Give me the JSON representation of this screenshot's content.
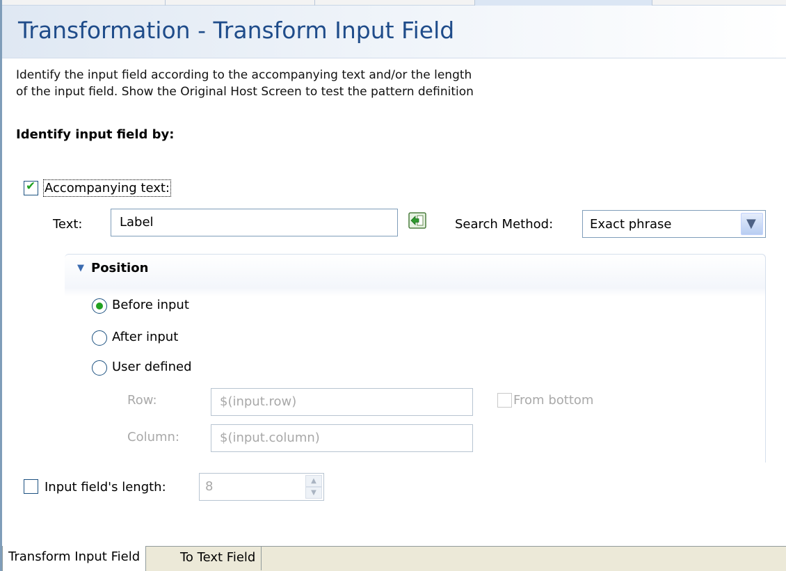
{
  "page": {
    "title": "Transformation - Transform Input Field",
    "description_line1": "Identify the input field according to the accompanying text and/or the length",
    "description_line2": "of the input field. Show the Original Host Screen to test the pattern definition",
    "section_heading": "Identify input field by:"
  },
  "accompanying": {
    "checkbox_label": "Accompanying text:",
    "checked": true,
    "text_label": "Text:",
    "text_value": "Label",
    "insert_icon": "insert-variable-icon",
    "search_method_label": "Search Method:",
    "search_method_value": "Exact phrase"
  },
  "position": {
    "header": "Position",
    "options": [
      "Before input",
      "After input",
      "User defined"
    ],
    "selected": "Before input",
    "row_label": "Row:",
    "row_value": "$(input.row)",
    "column_label": "Column:",
    "column_value": "$(input.column)",
    "from_bottom_label": "From bottom"
  },
  "length": {
    "checkbox_label": "Input field's length:",
    "checked": false,
    "value": "8"
  },
  "tabs": [
    "Transform Input Field",
    "To Text Field"
  ],
  "colors": {
    "title": "#1f4c8a",
    "check_green": "#21a121",
    "border_blue": "#7f9db9",
    "tab_bar": "#ece9d8"
  }
}
